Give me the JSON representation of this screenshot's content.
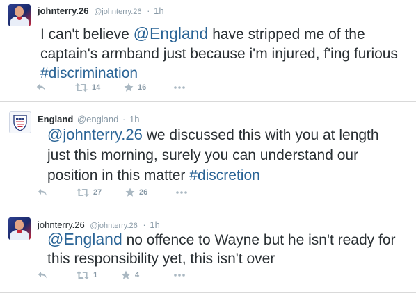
{
  "tweets": [
    {
      "name": "johnterry.26",
      "handle": "@johnterry.26",
      "sep": "·",
      "time": "1h",
      "avatar": "player-avatar",
      "segments": [
        {
          "type": "text",
          "text": "I can't believe "
        },
        {
          "type": "mention",
          "text": "@England"
        },
        {
          "type": "text",
          "text": " have stripped me of the captain's armband just because i'm injured, f'ing furious "
        },
        {
          "type": "hashtag",
          "text": "#discrimination"
        }
      ],
      "retweets": "14",
      "favorites": "16"
    },
    {
      "name": "England",
      "handle": "@england",
      "sep": "·",
      "time": "1h",
      "avatar": "crest-avatar",
      "segments": [
        {
          "type": "mention",
          "text": "@johnterry.26"
        },
        {
          "type": "text",
          "text": " we discussed this with you at length just this morning, surely you can understand our position in this matter  "
        },
        {
          "type": "hashtag",
          "text": "#discretion"
        }
      ],
      "retweets": "27",
      "favorites": "26"
    },
    {
      "name": "johnterry.26",
      "handle": "@johnterry.26",
      "sep": "·",
      "time": "1h",
      "avatar": "player-avatar",
      "segments": [
        {
          "type": "mention",
          "text": "@England"
        },
        {
          "type": "text",
          "text": " no offence to Wayne but he isn't ready for this responsibility yet, this isn't over"
        }
      ],
      "retweets": "1",
      "favorites": "4"
    }
  ],
  "icons": {
    "reply": "reply-icon",
    "retweet": "retweet-icon",
    "favorite": "star-icon",
    "more": "more-icon"
  },
  "colors": {
    "link": "#2a6496",
    "meta": "#8899a6",
    "text": "#292f33",
    "divider": "#d9d9d9"
  }
}
